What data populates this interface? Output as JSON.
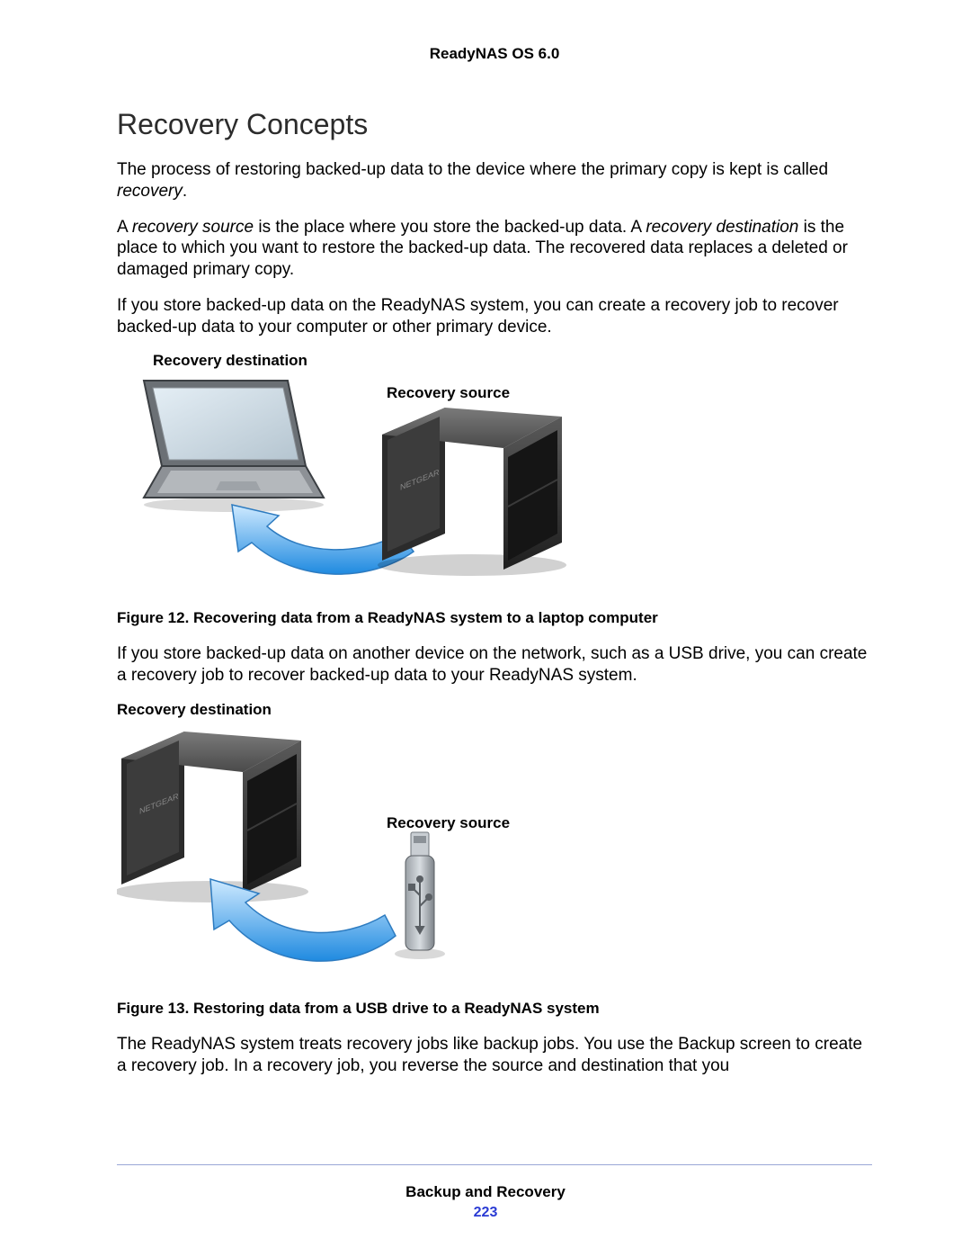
{
  "header": {
    "product": "ReadyNAS OS 6.0"
  },
  "section": {
    "title": "Recovery Concepts"
  },
  "para": {
    "p1a": "The process of restoring backed-up data to the device where the primary copy is kept is called ",
    "p1b": "recovery",
    "p1c": ".",
    "p2a": "A ",
    "p2b": "recovery source",
    "p2c": " is the place where you store the backed-up data. A ",
    "p2d": "recovery destination",
    "p2e": " is the place to which you want to restore the backed-up data. The recovered data replaces a deleted or damaged primary copy.",
    "p3": "If you store backed-up data on the ReadyNAS system, you can create a recovery job to recover backed-up data to your computer or other primary device.",
    "p4": "If you store backed-up data on another device on the network, such as a USB drive, you can create a recovery job to recover backed-up data to your ReadyNAS system.",
    "p5": "The ReadyNAS system treats recovery jobs like backup jobs. You use the Backup screen to create a recovery job. In a recovery job, you reverse the source and destination that you"
  },
  "labels": {
    "recovery_destination": "Recovery destination",
    "recovery_source": "Recovery source"
  },
  "figcap": {
    "f12": "Figure 12. Recovering data from a ReadyNAS system to a laptop computer",
    "f13": "Figure 13. Restoring data from a USB drive to a ReadyNAS system"
  },
  "footer": {
    "chapter": "Backup and Recovery",
    "page": "223"
  }
}
